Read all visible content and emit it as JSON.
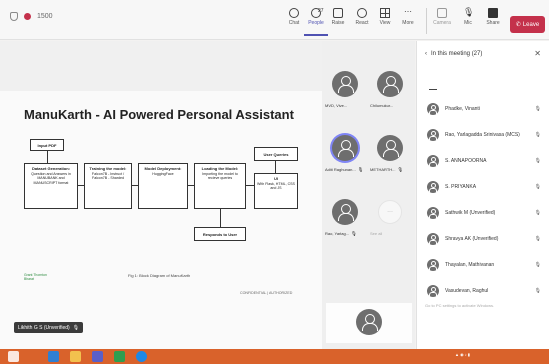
{
  "toolbar": {
    "time": "1500",
    "buttons": [
      {
        "label": "Chat",
        "icon": "chat-icon"
      },
      {
        "label": "People",
        "icon": "people-icon",
        "count": "27",
        "active": true
      },
      {
        "label": "Raise",
        "icon": "raise-hand-icon"
      },
      {
        "label": "React",
        "icon": "react-icon"
      },
      {
        "label": "View",
        "icon": "view-icon"
      },
      {
        "label": "More",
        "icon": "more-icon"
      },
      {
        "label": "Camera",
        "icon": "camera-icon"
      },
      {
        "label": "Mic",
        "icon": "mic-icon"
      },
      {
        "label": "Share",
        "icon": "share-icon"
      }
    ],
    "leave_label": "Leave"
  },
  "slide": {
    "title": "ManuKarth - AI Powered Personal Assistant",
    "input_pdf": "Input PDF",
    "dataset_title": "Dataset Generation:",
    "dataset_body": "Question and Answers in MANUBANK and MANUSCRIPT format",
    "training_title": "Training the model:",
    "training_body": "Falcon7B - Instruct / Falcon7B - Sharded",
    "deploy_title": "Model Deployment:",
    "deploy_body": "HuggingFace",
    "loading_title": "Loading the Model:",
    "loading_body": "Importing the model to recieve queries",
    "ui_title": "UI",
    "ui_body": "With Flask, HTML, CSS and JS",
    "user_queries": "User Queries",
    "responds": "Responds to User",
    "caption": "Fig 1: Block Diagram of ManuKarth",
    "confidential": "CONFIDENTIAL | AUTHORIZED",
    "logo_text": "Grant Thornton Bharat"
  },
  "presenter_tag": "Likhith G S (Unverified)",
  "video_tiles": [
    {
      "name": "MVD, Vive..."
    },
    {
      "name": "Chilumukur..."
    },
    {
      "name": "Aditi Raghunan..."
    },
    {
      "name": "METHARTH..."
    },
    {
      "name": "Rao, Yarlag..."
    }
  ],
  "see_all": {
    "icon": "...",
    "label": "See all"
  },
  "panel": {
    "title": "In this meeting (27)",
    "participants": [
      {
        "name": "Phadke, Vinanti"
      },
      {
        "name": "Rao, Yarlagadda Srinivasa (MCS)"
      },
      {
        "name": "S. ANNAPOORNA"
      },
      {
        "name": "S. PRIYANKA"
      },
      {
        "name": "Sathwik M (Unverified)"
      },
      {
        "name": "Shravya AK (Unverified)"
      },
      {
        "name": "Thayalan, Mathivanan"
      },
      {
        "name": "Vasudevan, Raghul"
      }
    ],
    "activate_text": "Go to PC settings to activate Windows."
  },
  "colors": {
    "leave": "#c4314b",
    "accent": "#4f52b2",
    "taskbar": "#d9622b"
  }
}
